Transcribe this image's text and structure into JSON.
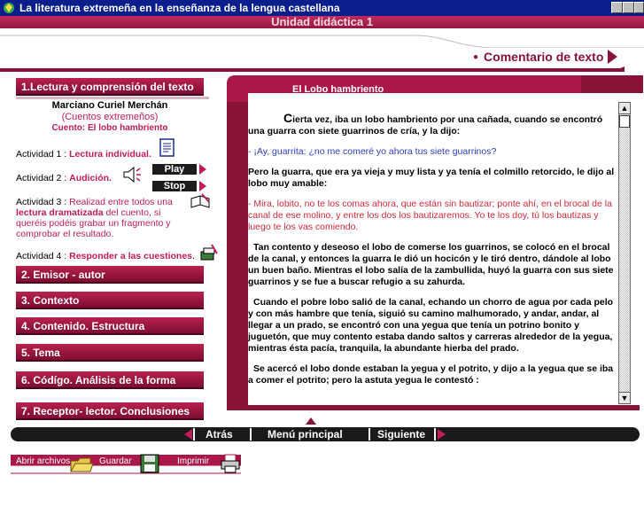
{
  "window": {
    "title": "La literatura extremeña en la enseñanza de la lengua castellana"
  },
  "unit": {
    "title": "Unidad didáctica 1"
  },
  "section": {
    "label": "Comentario de texto"
  },
  "menu": {
    "items": [
      {
        "label": "1.Lectura y comprensión del texto"
      },
      {
        "label": "2. Emisor - autor"
      },
      {
        "label": "3. Contexto"
      },
      {
        "label": "4. Contenido. Estructura"
      },
      {
        "label": "5. Tema"
      },
      {
        "label": "6. Códígo. Análisis de la forma"
      },
      {
        "label": "7. Receptor- lector. Conclusiones"
      }
    ]
  },
  "story_info": {
    "author": "Marciano Curiel Merchán",
    "collection": "(Cuentos extremeños)",
    "story": "Cuento: El lobo hambriento"
  },
  "activities": {
    "a1_prefix": "Actividad 1 : ",
    "a1_link": "Lectura individual.",
    "a2_prefix": "Actividad 2 : ",
    "a2_link": "Audición.",
    "play_label": "Play",
    "stop_label": "Stop",
    "a3_prefix": "Actividad 3 : ",
    "a3_text1": "Realizad entre todos una ",
    "a3_bold": "lectura dramatizada",
    "a3_text2": " del cuento, si queréis podéis grabar un fragmento y comprobar el resultado.",
    "a4_prefix": "Actividad 4 : ",
    "a4_text": "Responder a las ",
    "a4_link": "cuestiones",
    "a4_end": "."
  },
  "reading": {
    "title": "El Lobo hambriento",
    "p1_cap": "C",
    "p1": "ierta vez, iba un lobo hambriento por una cañada, cuando se encontró una guarra con siete guarrinos de cría, y la dijo:",
    "p2": "- ¡Ay, guarrita: ¿no me comeré yo ahora tus siete guarrinos?",
    "p3": "Pero la guarra, que era ya vieja y muy lista y ya tenía el colmillo retorcido, le dijo al lobo muy amable:",
    "p4": "- Mira, lobito, no te los comas ahora, que están sin bautizar; ponte ahí, en el brocal de la canal de ese molino, y entre los dos los bautizaremos. Yo te los doy, tú los bautizas y luego te los vas comiendo.",
    "p5": "Tan contento y deseoso el lobo de comerse los guarrinos, se colocó en el brocal de la canal, y entonces la guarra le dió un hocicón y le tiró dentro, dándole al lobo un buen baño. Mientras el lobo salía de la zambullida, huyó la guarra con sus siete guarrinos y se fue a buscar refugio a su zahurda.",
    "p6": "Cuando el pobre lobo salió de la canal, echando un chorro de agua por cada pelo y con más hambre que tenía, siguió su camino malhumorado, y andar, andar, al llegar a un prado, se encontró con una yegua que tenía un potrino bonito y juguetón, que muy contento estaba dando saltos y carreras alrededor de la yegua, mientras ésta pacía, tranquila, la abundante hierba del prado.",
    "p7": "Se acercó el lobo donde estaban la yegua y el potrito, y dijo a la yegua que se iba a comer el potrito; pero la astuta yegua le contestó :"
  },
  "nav": {
    "back": "Atrás",
    "main": "Menú principal",
    "next": "Siguiente"
  },
  "toolbar": {
    "open": "Abrir archivos",
    "save": "Guardar",
    "print": "Imprimir"
  },
  "colors": {
    "brand": "#8a1237",
    "accent": "#c21b5a",
    "titlebar": "#0a1e8c",
    "dialog_blue": "#2c3cc4",
    "dialog_red": "#d0293a"
  },
  "icons": [
    "app-icon",
    "document-icon",
    "speaker-icon",
    "pencil-book-icon",
    "questions-icon",
    "folder-icon",
    "save-icon",
    "print-icon"
  ]
}
